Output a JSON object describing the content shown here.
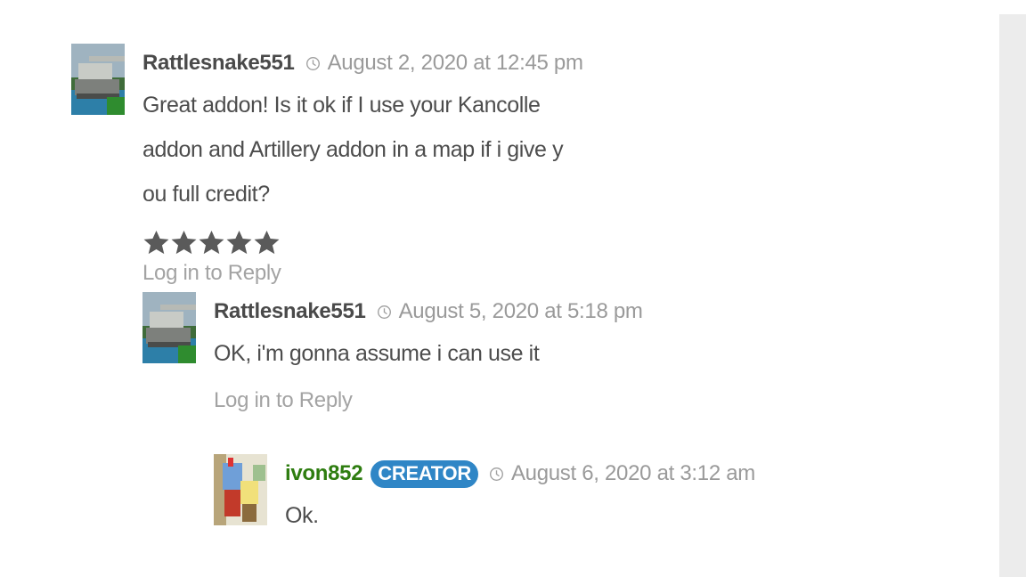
{
  "comments": [
    {
      "author": "Rattlesnake551",
      "date": "August 2, 2020 at 12:45 pm",
      "text": "Great addon! Is it ok if I use your Kancolle addon and Artillery addon in a map if i give y",
      "text_line2": "ou full credit?",
      "rating": 5,
      "reply_label": "Log in to Reply",
      "avatar_icon": "tank-avatar"
    },
    {
      "author": "Rattlesnake551",
      "date": "August 5, 2020 at 5:18 pm",
      "text": "OK, i'm gonna assume i can use it",
      "reply_label": "Log in to Reply",
      "avatar_icon": "tank-avatar"
    },
    {
      "author": "ivon852",
      "badge": "CREATOR",
      "date": "August 6, 2020 at 3:12 am",
      "text": "Ok.",
      "avatar_icon": "cartoon-avatar"
    }
  ],
  "colors": {
    "creator_badge": "#2f86c6",
    "creator_name": "#2e7d10",
    "star": "#5a5a5a",
    "meta_text": "#9a9a9a"
  },
  "icons": [
    "clock-icon",
    "star-icon"
  ]
}
